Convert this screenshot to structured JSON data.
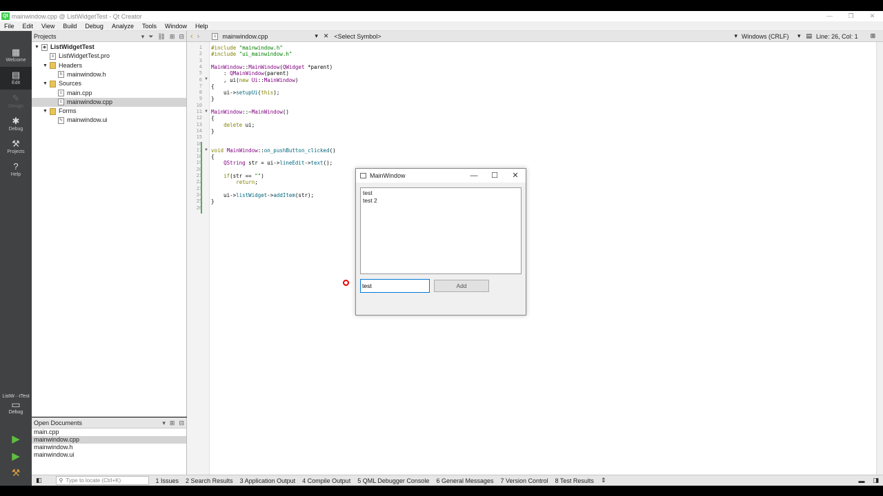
{
  "window": {
    "title": "mainwindow.cpp @ ListWidgetTest - Qt Creator",
    "icon": "qt-icon",
    "app_icon_text": "Qt"
  },
  "menu": [
    "File",
    "Edit",
    "View",
    "Build",
    "Debug",
    "Analyze",
    "Tools",
    "Window",
    "Help"
  ],
  "modes": [
    {
      "label": "Welcome",
      "icon": "grid-icon",
      "glyph": "▦"
    },
    {
      "label": "Edit",
      "icon": "edit-doc-icon",
      "glyph": "▤"
    },
    {
      "label": "Design",
      "icon": "pencil-icon",
      "glyph": "✎"
    },
    {
      "label": "Debug",
      "icon": "bug-icon",
      "glyph": "✱"
    },
    {
      "label": "Projects",
      "icon": "wrench-icon",
      "glyph": "⚒"
    },
    {
      "label": "Help",
      "icon": "help-icon",
      "glyph": "?"
    }
  ],
  "kit": {
    "project": "ListW···tTest",
    "mode": "Debug",
    "glyph": "▭"
  },
  "run_glyphs": {
    "run": "▶",
    "debug_run": "▶",
    "build": "⚒"
  },
  "projects_pane": {
    "title": "Projects",
    "tree": [
      {
        "label": "ListWidgetTest",
        "level": 0,
        "arrow": "▼",
        "bold": true,
        "glyph": "◆"
      },
      {
        "label": "ListWidgetTest.pro",
        "level": 1,
        "arrow": "",
        "glyph": "≡"
      },
      {
        "label": "Headers",
        "level": 1,
        "arrow": "▼",
        "folder": true
      },
      {
        "label": "mainwindow.h",
        "level": 2,
        "arrow": "",
        "glyph": "h"
      },
      {
        "label": "Sources",
        "level": 1,
        "arrow": "▼",
        "folder": true
      },
      {
        "label": "main.cpp",
        "level": 2,
        "arrow": "",
        "glyph": "c"
      },
      {
        "label": "mainwindow.cpp",
        "level": 2,
        "arrow": "",
        "glyph": "c",
        "selected": true
      },
      {
        "label": "Forms",
        "level": 1,
        "arrow": "▼",
        "folder": true
      },
      {
        "label": "mainwindow.ui",
        "level": 2,
        "arrow": "",
        "glyph": "✎"
      }
    ]
  },
  "open_documents": {
    "title": "Open Documents",
    "items": [
      "main.cpp",
      "mainwindow.cpp",
      "mainwindow.h",
      "mainwindow.ui"
    ],
    "selected_index": 1
  },
  "editor_toolbar": {
    "nav_back": "‹",
    "nav_fwd": "›",
    "file": "mainwindow.cpp",
    "file_glyph": "c",
    "dropdown": "▾",
    "close": "✕",
    "symbol": "<Select Symbol>",
    "line_ending": "Windows (CRLF)",
    "position": "Line: 26, Col: 1"
  },
  "code": [
    {
      "n": "1",
      "t": "#include \"mainwindow.h\""
    },
    {
      "n": "2",
      "t": "#include \"ui_mainwindow.h\""
    },
    {
      "n": "3",
      "t": ""
    },
    {
      "n": "4",
      "t": "MainWindow::MainWindow(QWidget *parent)"
    },
    {
      "n": "5",
      "t": "    : QMainWindow(parent)"
    },
    {
      "n": "6",
      "t": "    , ui(new Ui::MainWindow)"
    },
    {
      "n": "7",
      "t": "{"
    },
    {
      "n": "8",
      "t": "    ui->setupUi(this);"
    },
    {
      "n": "9",
      "t": "}"
    },
    {
      "n": "10",
      "t": ""
    },
    {
      "n": "11",
      "t": "MainWindow::~MainWindow()"
    },
    {
      "n": "12",
      "t": "{"
    },
    {
      "n": "13",
      "t": "    delete ui;"
    },
    {
      "n": "14",
      "t": "}"
    },
    {
      "n": "15",
      "t": ""
    },
    {
      "n": "16",
      "t": ""
    },
    {
      "n": "17",
      "t": "void MainWindow::on_pushButton_clicked()"
    },
    {
      "n": "18",
      "t": "{"
    },
    {
      "n": "19",
      "t": "    QString str = ui->lineEdit->text();"
    },
    {
      "n": "20",
      "t": ""
    },
    {
      "n": "21",
      "t": "    if(str == \"\")"
    },
    {
      "n": "22",
      "t": "        return;"
    },
    {
      "n": "23",
      "t": ""
    },
    {
      "n": "24",
      "t": "    ui->listWidget->addItem(str);"
    },
    {
      "n": "25",
      "t": "}"
    },
    {
      "n": "26",
      "t": ""
    }
  ],
  "status_bar": {
    "locate_placeholder": "Type to locate (Ctrl+K)",
    "tabs": [
      "1  Issues",
      "2  Search Results",
      "3  Application Output",
      "4  Compile Output",
      "5  QML Debugger Console",
      "6  General Messages",
      "7  Version Control",
      "8  Test Results"
    ],
    "more": "⇕"
  },
  "app_window": {
    "title": "MainWindow",
    "minimize": "—",
    "maximize": "☐",
    "close": "✕",
    "list_items": [
      "test",
      "test 2"
    ],
    "line_edit_value": "test",
    "add_button": "Add"
  }
}
